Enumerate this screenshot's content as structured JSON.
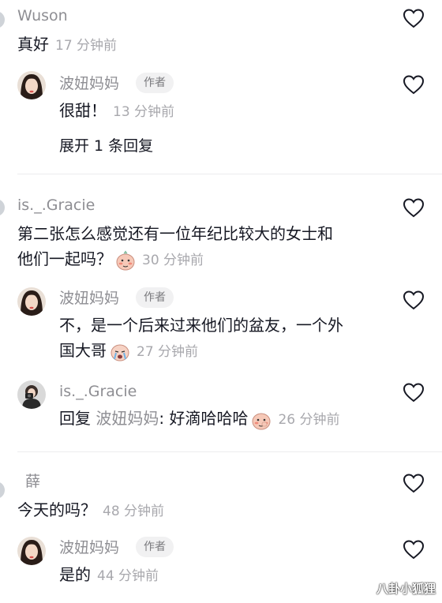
{
  "colors": {
    "username": "#8e8e93",
    "text": "#161823",
    "time": "#a8a8ad",
    "tag_bg": "#f1f1f2"
  },
  "comments": [
    {
      "username": "Wuson",
      "text": "真好",
      "time": "17 分钟前",
      "replies": [
        {
          "username": "波妞妈妈",
          "tag": "作者",
          "text": "很甜！",
          "time": "13 分钟前"
        }
      ],
      "expand_label": "展开 1 条回复"
    },
    {
      "username": "is._.Gracie",
      "text_line1": "第二张怎么感觉还有一位年纪比较大的女士和",
      "text_line2": "他们一起吗？",
      "time": "30 分钟前",
      "replies": [
        {
          "username": "波妞妈妈",
          "tag": "作者",
          "text_line1": "不，是一个后来过来他们的盆友，一个外",
          "text_line2": "国大哥",
          "time": "27 分钟前"
        },
        {
          "username": "is._.Gracie",
          "reply_prefix": "回复",
          "reply_to": "波妞妈妈",
          "text": ": 好滴哈哈哈",
          "time": "26 分钟前"
        }
      ]
    },
    {
      "username": "薛",
      "text": "今天的吗？",
      "time": "48 分钟前",
      "replies": [
        {
          "username": "波妞妈妈",
          "tag": "作者",
          "text": "是的",
          "time": "44 分钟前"
        }
      ]
    }
  ],
  "watermark": "八卦小狐狸",
  "icons": {
    "like": "heart-outline-icon",
    "emoji_blush": "blush-face-emoji",
    "emoji_cry": "crying-face-emoji"
  }
}
